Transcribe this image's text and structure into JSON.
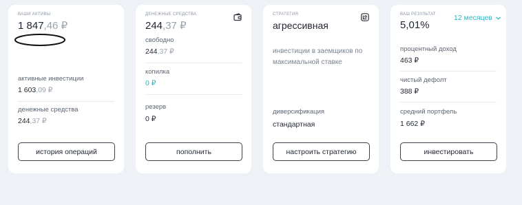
{
  "card_assets": {
    "caption": "ваши активы",
    "total_int": "1 847",
    "total_frac": ",46 ₽",
    "active_label": "активные инвестиции",
    "active_int": "1 603",
    "active_frac": ",09 ₽",
    "cash_label": "денежные средства",
    "cash_int": "244",
    "cash_frac": ",37 ₽",
    "button": "история операций"
  },
  "card_cash": {
    "caption": "денежные средства",
    "total_int": "244",
    "total_frac": ",37 ₽",
    "icon": "wallet-icon",
    "free_label": "свободно",
    "free_int": "244",
    "free_frac": ",37 ₽",
    "piggy_label": "копилка",
    "piggy_value": "0 ₽",
    "reserve_label": "резерв",
    "reserve_value": "0 ₽",
    "button": "пополнить"
  },
  "card_strategy": {
    "caption": "стратегия",
    "icon": "strategy-icon",
    "title": "агрессивная",
    "description": "инвестиции в заемщиков по максимальной ставке",
    "diversification_label": "диверсификация",
    "diversification_value": "стандартная",
    "button": "настроить стратегию"
  },
  "card_result": {
    "caption": "ваш результат",
    "period": "12 месяцев",
    "rate": "5,01%",
    "interest_label": "процентный доход",
    "interest_value": "463 ₽",
    "default_label": "чистый дефолт",
    "default_value": "388 ₽",
    "portfolio_label": "средний портфель",
    "portfolio_value": "1 662 ₽",
    "button": "инвестировать"
  },
  "colors": {
    "accent": "#2bb6c6",
    "background": "#eef1f5",
    "card": "#ffffff",
    "text": "#1f2430",
    "muted": "#9aa3b0"
  }
}
